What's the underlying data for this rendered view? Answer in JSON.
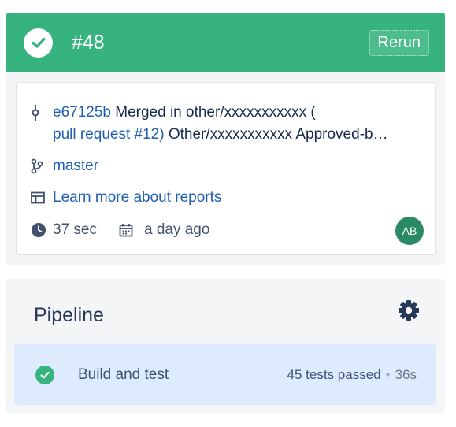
{
  "build": {
    "number": "#48",
    "rerun_label": "Rerun",
    "status": "success",
    "colors": {
      "success": "#36b37e",
      "link": "#2160b0"
    }
  },
  "details": {
    "commit_hash": "e67125b",
    "commit_message_line1": "Merged in other/xxxxxxxxxxx (",
    "commit_link_line2": "pull request #12)",
    "commit_message_line2": "Other/xxxxxxxxxxx Approved-b…",
    "branch": "master",
    "reports_link": "Learn more about reports",
    "duration": "37 sec",
    "started": "a day ago",
    "avatar_initials": "AB"
  },
  "pipeline": {
    "title": "Pipeline",
    "steps": [
      {
        "name": "Build and test",
        "tests": "45 tests passed",
        "separator": "•",
        "duration": "36s",
        "status": "success"
      }
    ]
  },
  "icons": [
    "check-circle-icon",
    "commit-icon",
    "branch-icon",
    "reports-icon",
    "clock-icon",
    "calendar-icon",
    "gear-icon"
  ]
}
